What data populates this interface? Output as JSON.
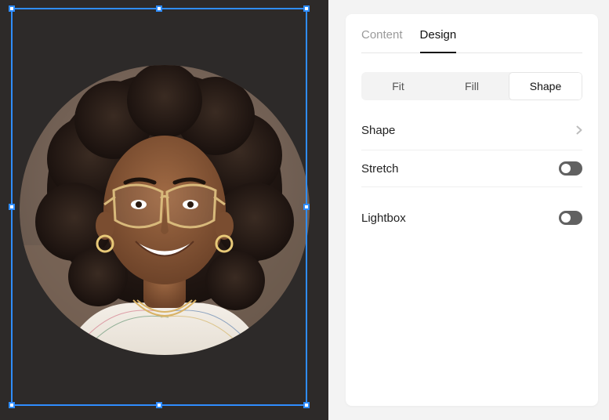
{
  "inspector": {
    "tabs": {
      "content": "Content",
      "design": "Design"
    },
    "active_tab": "design",
    "segmented": {
      "fit": "Fit",
      "fill": "Fill",
      "shape": "Shape"
    },
    "active_segment": "shape",
    "rows": {
      "shape_label": "Shape",
      "stretch_label": "Stretch",
      "stretch_on": false,
      "lightbox_label": "Lightbox",
      "lightbox_on": false
    }
  },
  "canvas": {
    "selection": {
      "name": "image-block"
    }
  },
  "colors": {
    "canvas_bg": "#2d2a29",
    "selection": "#2f8dff",
    "panel_bg": "#ffffff",
    "app_bg": "#f3f3f3"
  }
}
